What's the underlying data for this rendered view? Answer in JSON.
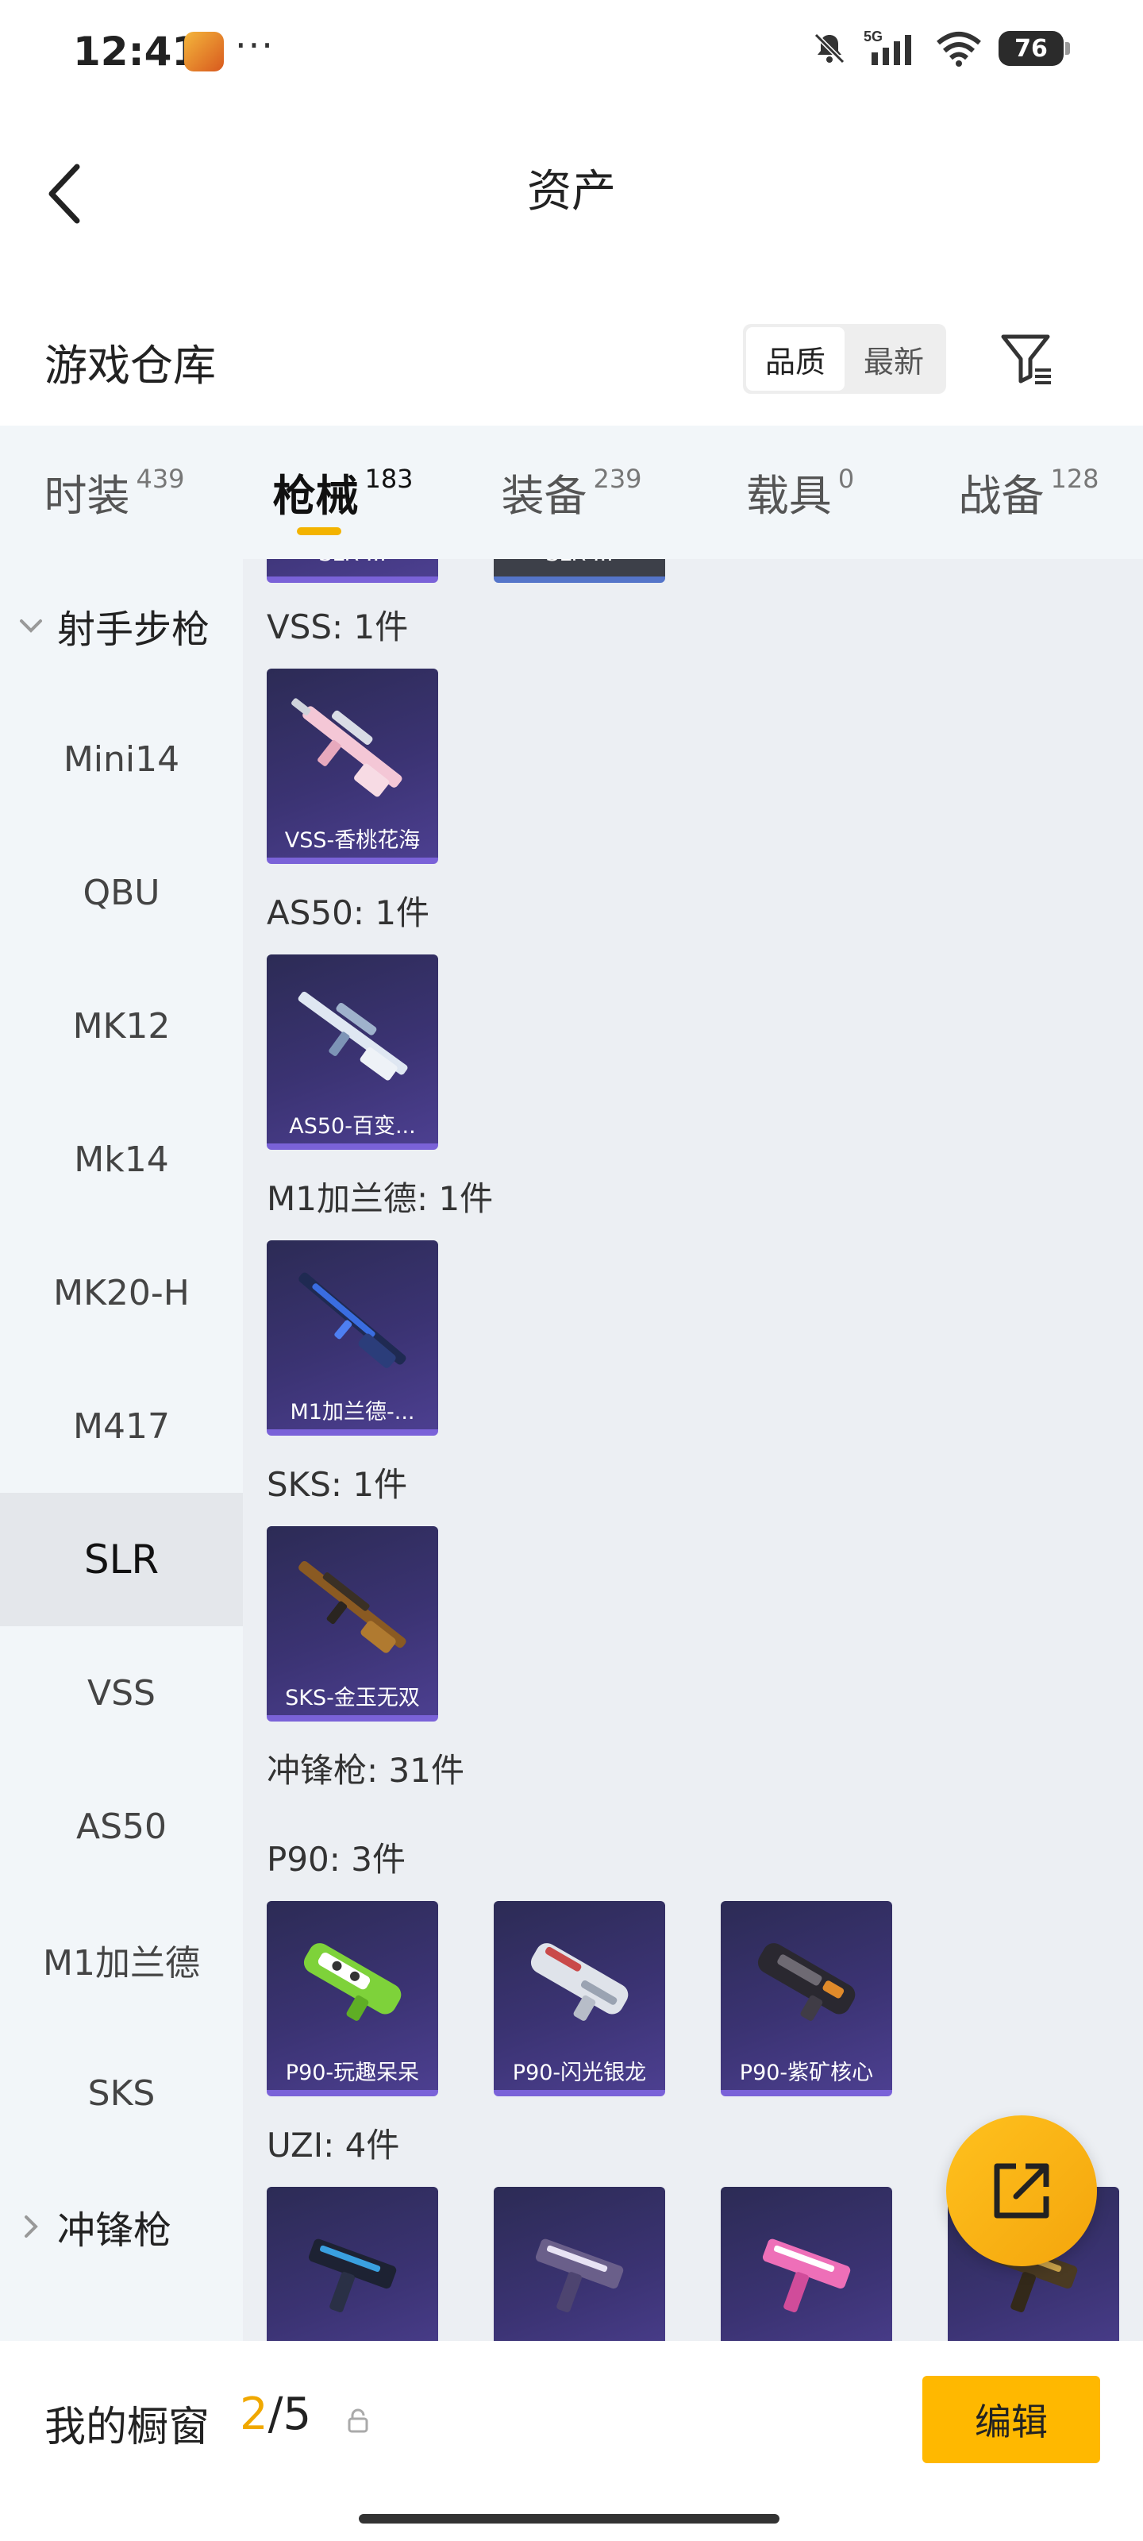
{
  "status_bar": {
    "time": "12:41",
    "more_dots": "···",
    "network": "5G",
    "battery": "76"
  },
  "header": {
    "title": "资产"
  },
  "warehouse": {
    "title": "游戏仓库",
    "sort_options": [
      "品质",
      "最新"
    ],
    "active_sort": "品质"
  },
  "tabs": [
    {
      "label": "时装",
      "count": "439"
    },
    {
      "label": "枪械",
      "count": "183"
    },
    {
      "label": "装备",
      "count": "239"
    },
    {
      "label": "载具",
      "count": "0"
    },
    {
      "label": "战备",
      "count": "128"
    }
  ],
  "active_tab": "枪械",
  "sidebar": {
    "group1": "射手步枪",
    "items": [
      "Mini14",
      "QBU",
      "MK12",
      "Mk14",
      "MK20-H",
      "M417",
      "SLR",
      "VSS",
      "AS50",
      "M1加兰德",
      "SKS"
    ],
    "active_item": "SLR",
    "group2": "冲锋枪"
  },
  "content": {
    "top_partial": [
      "SLR-...",
      "SLR-..."
    ],
    "sections": [
      {
        "label": "VSS: 1件",
        "items": [
          "VSS-香桃花海"
        ]
      },
      {
        "label": "AS50: 1件",
        "items": [
          "AS50-百变..."
        ]
      },
      {
        "label": "M1加兰德: 1件",
        "items": [
          "M1加兰德-..."
        ]
      },
      {
        "label": "SKS: 1件",
        "items": [
          "SKS-金玉无双"
        ]
      }
    ],
    "category_label": "冲锋枪: 31件",
    "p90": {
      "label": "P90: 3件",
      "items": [
        "P90-玩趣呆呆",
        "P90-闪光银龙",
        "P90-紫矿核心"
      ]
    },
    "uzi": {
      "label": "UZI: 4件"
    }
  },
  "bottom": {
    "showcase_label": "我的橱窗",
    "showcase_current": "2",
    "showcase_total": "/5",
    "edit_label": "编辑"
  },
  "colors": {
    "accent": "#ffb800",
    "card_bg": "#3b3373",
    "card_border": "#7a62d8"
  }
}
